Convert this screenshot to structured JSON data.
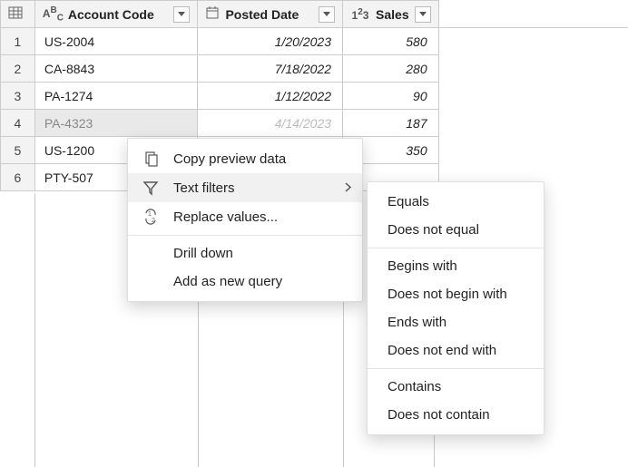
{
  "columns": {
    "account": {
      "label": "Account Code",
      "type_label": "ABC"
    },
    "date": {
      "label": "Posted Date"
    },
    "sales": {
      "label": "Sales",
      "type_label": "123"
    }
  },
  "rows": [
    {
      "n": "1",
      "account": "US-2004",
      "date": "1/20/2023",
      "sales": "580"
    },
    {
      "n": "2",
      "account": "CA-8843",
      "date": "7/18/2022",
      "sales": "280"
    },
    {
      "n": "3",
      "account": "PA-1274",
      "date": "1/12/2022",
      "sales": "90"
    },
    {
      "n": "4",
      "account": "PA-4323",
      "date": "4/14/2023",
      "sales": "187"
    },
    {
      "n": "5",
      "account": "US-1200",
      "date": "",
      "sales": "350"
    },
    {
      "n": "6",
      "account": "PTY-507",
      "date": "",
      "sales": ""
    }
  ],
  "context_menu": {
    "copy": "Copy preview data",
    "text_filters": "Text filters",
    "replace": "Replace values...",
    "drill": "Drill down",
    "add_query": "Add as new query"
  },
  "text_filter_submenu": {
    "equals": "Equals",
    "not_equal": "Does not equal",
    "begins": "Begins with",
    "not_begin": "Does not begin with",
    "ends": "Ends with",
    "not_end": "Does not end with",
    "contains": "Contains",
    "not_contain": "Does not contain"
  }
}
